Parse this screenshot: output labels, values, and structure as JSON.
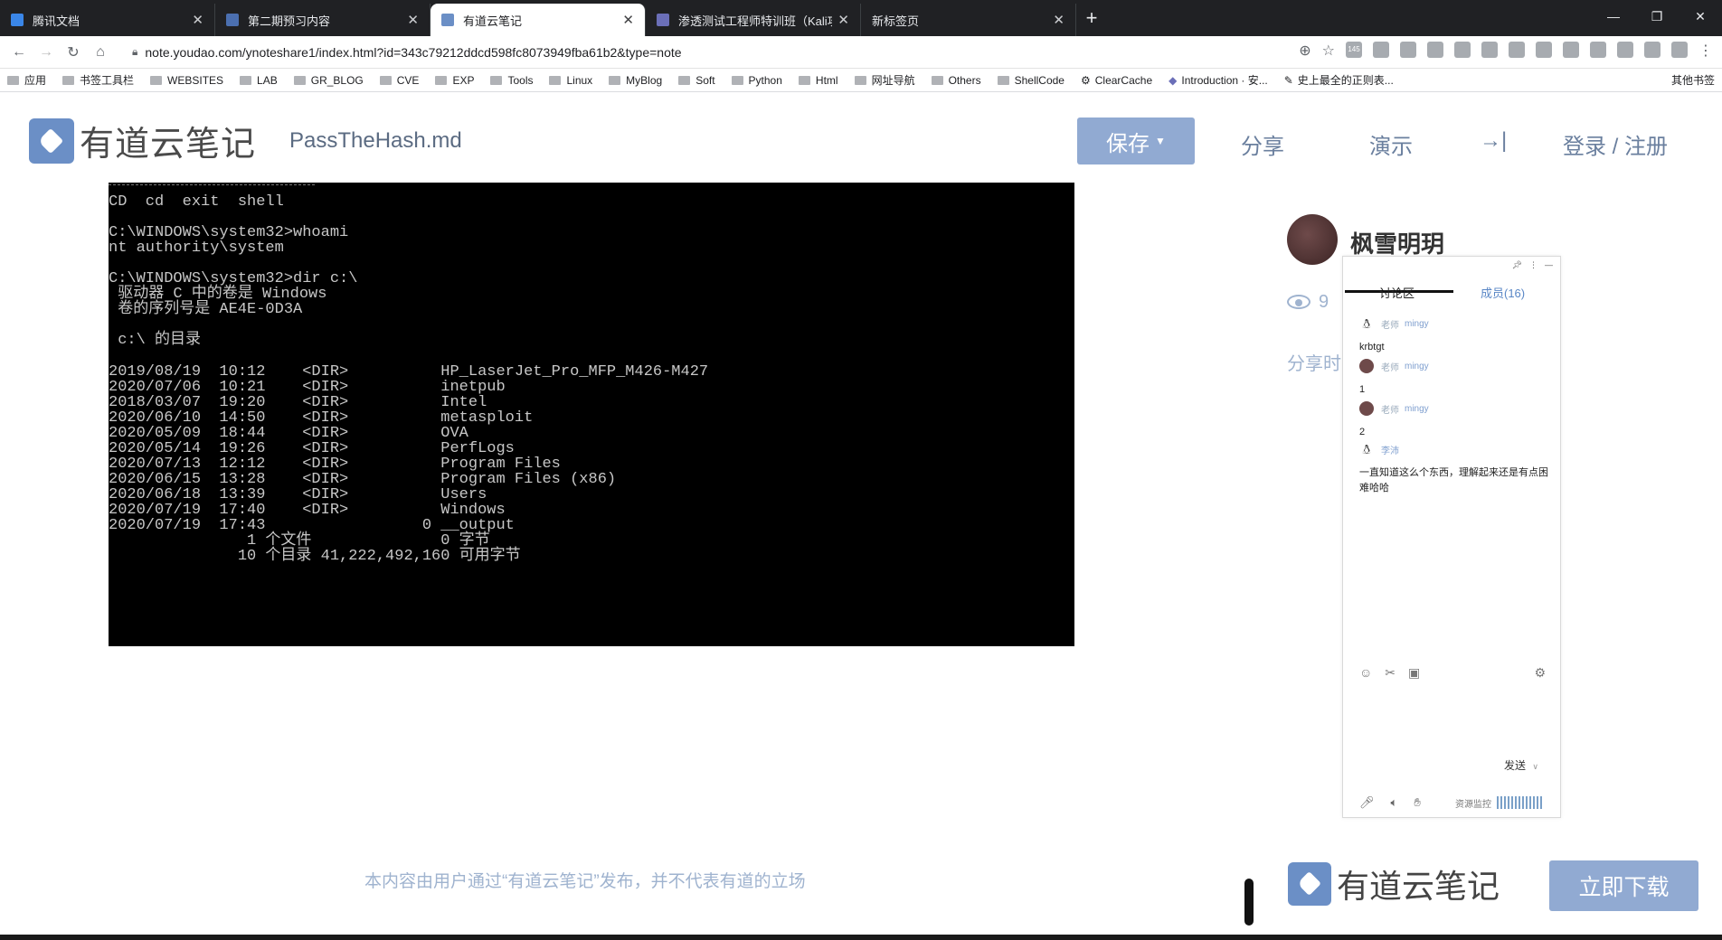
{
  "browser": {
    "tabs": [
      {
        "title": "腾讯文档",
        "favicon_color": "#3a86e8",
        "active": false
      },
      {
        "title": "第二期预习内容",
        "favicon_color": "#4b6fb0",
        "active": false
      },
      {
        "title": "有道云笔记",
        "favicon_color": "#6b8fc6",
        "active": true
      },
      {
        "title": "渗透测试工程师特训班（Kali攻",
        "favicon_color": "#6b6fb8",
        "active": false
      },
      {
        "title": "新标签页",
        "favicon_color": "#202124",
        "active": false
      }
    ],
    "new_tab": "+",
    "window_controls": [
      "—",
      "❐",
      "✕"
    ],
    "url": "note.youdao.com/ynoteshare1/index.html?id=343c79212ddcd598fc8073949fba61b2&type=note",
    "ext_badge": "145",
    "bookmarks": [
      "应用",
      "书签工具栏",
      "WEBSITES",
      "LAB",
      "GR_BLOG",
      "CVE",
      "EXP",
      "Tools",
      "Linux",
      "MyBlog",
      "Soft",
      "Python",
      "Html",
      "网址导航",
      "Others",
      "ShellCode",
      "ClearCache",
      "Introduction · 安...",
      "史上最全的正则表..."
    ],
    "bookmarks_more": "其他书签"
  },
  "header": {
    "logo_text": "有道云笔记",
    "doc_title": "PassTheHash.md",
    "save_label": "保存",
    "share_label": "分享",
    "present_label": "演示",
    "collapse_icon": "→|",
    "login_label": "登录 / 注册"
  },
  "terminal": {
    "lines": [
      "CD  cd  exit  shell",
      "",
      "C:\\WINDOWS\\system32>whoami",
      "nt authority\\system",
      "",
      "C:\\WINDOWS\\system32>dir c:\\",
      " 驱动器 C 中的卷是 Windows",
      " 卷的序列号是 AE4E-0D3A",
      "",
      " c:\\ 的目录",
      "",
      "2019/08/19  10:12    <DIR>          HP_LaserJet_Pro_MFP_M426-M427",
      "2020/07/06  10:21    <DIR>          inetpub",
      "2018/03/07  19:20    <DIR>          Intel",
      "2020/06/10  14:50    <DIR>          metasploit",
      "2020/05/09  18:44    <DIR>          OVA",
      "2020/05/14  19:26    <DIR>          PerfLogs",
      "2020/07/13  12:12    <DIR>          Program Files",
      "2020/06/15  13:28    <DIR>          Program Files (x86)",
      "2020/06/18  13:39    <DIR>          Users",
      "2020/07/19  17:40    <DIR>          Windows",
      "2020/07/19  17:43                 0 __output",
      "               1 个文件              0 字节",
      "              10 个目录 41,222,492,160 可用字节"
    ]
  },
  "author": {
    "name": "枫雪明玥",
    "views": "9",
    "share_time_label": "分享时"
  },
  "chat": {
    "tab_discussion": "讨论区",
    "tab_members": "成员(16)",
    "messages": [
      {
        "role": "老师",
        "name": "mingy",
        "text": "krbtgt",
        "avatar": "penguin"
      },
      {
        "role": "老师",
        "name": "mingy",
        "text": "1",
        "avatar": "photo"
      },
      {
        "role": "老师",
        "name": "mingy",
        "text": "2",
        "avatar": "photo"
      },
      {
        "role": "",
        "name": "李沛",
        "text": "一直知道这么个东西，理解起来还是有点困难哈哈",
        "avatar": "penguin"
      }
    ],
    "send_label": "发送",
    "resource_monitor": "资源监控"
  },
  "footer": {
    "disclaimer": "本内容由用户通过“有道云笔记”发布，并不代表有道的立场",
    "logo_text": "有道云笔记",
    "download_label": "立即下载"
  }
}
